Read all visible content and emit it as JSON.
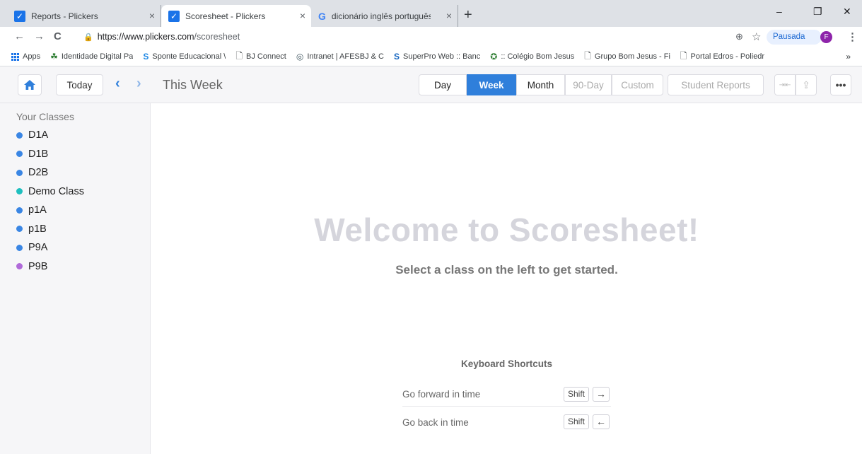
{
  "browser": {
    "tabs": [
      {
        "title": "Reports - Plickers",
        "icon": "plickers-check-icon"
      },
      {
        "title": "Scoresheet - Plickers",
        "icon": "plickers-check-icon"
      },
      {
        "title": "dicionário inglês português - Pes",
        "icon": "google-g-icon"
      }
    ],
    "tab_close": "×",
    "new_tab": "+",
    "window": {
      "minimize": "–",
      "restore": "❐",
      "close": "✕"
    },
    "nav": {
      "back": "←",
      "forward": "→",
      "reload": "C"
    },
    "url_scheme_host": "https://www.plickers.com",
    "url_path": "/scoresheet",
    "zoom_icon": "⊕",
    "star_icon": "☆",
    "profile_status": "Pausada",
    "profile_initial": "F",
    "menu_icon": "⋮",
    "bookmarks": [
      {
        "label": "Apps"
      },
      {
        "label": "Identidade Digital Pa",
        "icon": "☘"
      },
      {
        "label": "Sponte Educacional \\",
        "icon": "S"
      },
      {
        "label": "BJ Connect",
        "icon": "🗋"
      },
      {
        "label": "Intranet | AFESBJ & C",
        "icon": "◎"
      },
      {
        "label": "SuperPro Web :: Banc",
        "icon": "S"
      },
      {
        "label": ":: Colégio Bom Jesus",
        "icon": "✪"
      },
      {
        "label": "Grupo Bom Jesus - Fi",
        "icon": "🗋"
      },
      {
        "label": "Portal Edros - Poliedr",
        "icon": "🗋"
      }
    ],
    "bookmarks_more": "»"
  },
  "toolbar": {
    "today": "Today",
    "prev": "‹",
    "next": "›",
    "range_title": "This Week",
    "views": [
      "Day",
      "Week",
      "Month",
      "90-Day",
      "Custom"
    ],
    "selected_view": "Week",
    "student_reports": "Student Reports",
    "compress_icon": "⇥⇤",
    "export_icon": "⇪",
    "more_icon": "•••"
  },
  "sidebar": {
    "heading": "Your Classes",
    "classes": [
      {
        "name": "D1A",
        "color": "#3a86e4"
      },
      {
        "name": "D1B",
        "color": "#3a86e4"
      },
      {
        "name": "D2B",
        "color": "#3a86e4"
      },
      {
        "name": "Demo Class",
        "color": "#1ebfbf"
      },
      {
        "name": "p1A",
        "color": "#3a86e4"
      },
      {
        "name": "p1B",
        "color": "#3a86e4"
      },
      {
        "name": "P9A",
        "color": "#3a86e4"
      },
      {
        "name": "P9B",
        "color": "#b06ad9"
      }
    ]
  },
  "main": {
    "welcome": "Welcome to Scoresheet!",
    "subtitle": "Select a class on the left to get started.",
    "shortcuts_title": "Keyboard Shortcuts",
    "shortcuts": [
      {
        "label": "Go forward in time",
        "key": "Shift",
        "arrow": "→"
      },
      {
        "label": "Go back in time",
        "key": "Shift",
        "arrow": "←"
      }
    ]
  },
  "colors": {
    "accent": "#2f7fdb",
    "sidebar_bg": "#f6f6f8",
    "welcome_text": "#d5d5dc"
  }
}
